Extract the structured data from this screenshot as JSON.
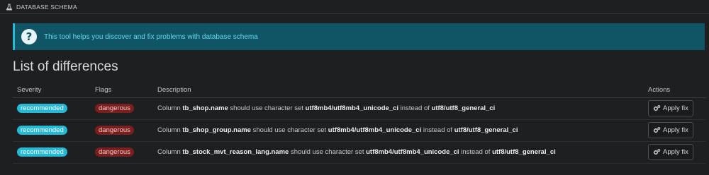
{
  "header": {
    "title": "DATABASE SCHEMA",
    "icon": "flask-icon"
  },
  "alert": {
    "icon": "question-circle-icon",
    "text": "This tool helps you discover and fix problems with database schema",
    "accent_color": "#25b9d7"
  },
  "section": {
    "title": "List of differences"
  },
  "table": {
    "headers": {
      "severity": "Severity",
      "flags": "Flags",
      "description": "Description",
      "actions": "Actions"
    },
    "rows": [
      {
        "severity": "recommended",
        "flag": "dangerous",
        "desc": {
          "pre": "Column ",
          "column": "tb_shop.name",
          "mid": " should use character set ",
          "target": "utf8mb4/utf8mb4_unicode_ci",
          "mid2": " instead of ",
          "current": "utf8/utf8_general_ci"
        },
        "action": "Apply fix"
      },
      {
        "severity": "recommended",
        "flag": "dangerous",
        "desc": {
          "pre": "Column ",
          "column": "tb_shop_group.name",
          "mid": " should use character set ",
          "target": "utf8mb4/utf8mb4_unicode_ci",
          "mid2": " instead of ",
          "current": "utf8/utf8_general_ci"
        },
        "action": "Apply fix"
      },
      {
        "severity": "recommended",
        "flag": "dangerous",
        "desc": {
          "pre": "Column ",
          "column": "tb_stock_mvt_reason_lang.name",
          "mid": " should use character set ",
          "target": "utf8mb4/utf8mb4_unicode_ci",
          "mid2": " instead of ",
          "current": "utf8/utf8_general_ci"
        },
        "action": "Apply fix"
      }
    ]
  },
  "colors": {
    "recommended": "#25b9d7",
    "dangerous": "#7a1e1e",
    "background": "#1e1f21",
    "alert_bg": "#0f5565"
  }
}
